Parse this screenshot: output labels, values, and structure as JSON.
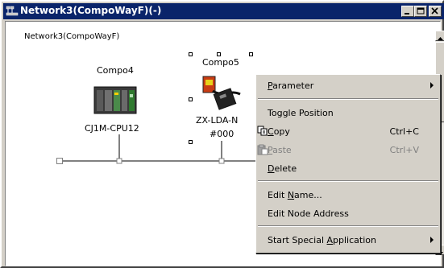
{
  "window": {
    "title": "Network3(CompoWayF)(-)"
  },
  "canvas": {
    "network_label": "Network3(CompoWayF)",
    "nodes": [
      {
        "name": "Compo4",
        "model": "CJ1M-CPU12"
      },
      {
        "name": "Compo5",
        "model": "ZX-LDA-N",
        "address": "#000"
      }
    ]
  },
  "context_menu": {
    "items": [
      {
        "label": "Parameter",
        "mnemonic": "P",
        "shortcut": "",
        "submenu": true,
        "disabled": false
      },
      {
        "label": "Toggle Position",
        "shortcut": "",
        "submenu": false,
        "disabled": false
      },
      {
        "label": "Copy",
        "mnemonic": "C",
        "shortcut": "Ctrl+C",
        "submenu": false,
        "disabled": false,
        "icon": "copy-icon"
      },
      {
        "label": "Paste",
        "mnemonic": "P",
        "shortcut": "Ctrl+V",
        "submenu": false,
        "disabled": true,
        "icon": "paste-icon"
      },
      {
        "label": "Delete",
        "mnemonic": "D",
        "shortcut": "",
        "submenu": false,
        "disabled": false
      },
      {
        "label": "Edit Name...",
        "mnemonic": "N",
        "shortcut": "",
        "submenu": false,
        "disabled": false
      },
      {
        "label": "Edit Node Address",
        "shortcut": "",
        "submenu": false,
        "disabled": false
      },
      {
        "label": "Start Special Application",
        "mnemonic": "A",
        "shortcut": "",
        "submenu": true,
        "disabled": false
      }
    ]
  },
  "colors": {
    "titlebar": "#0a246a",
    "face": "#d4d0c8",
    "bus": "#808080"
  }
}
